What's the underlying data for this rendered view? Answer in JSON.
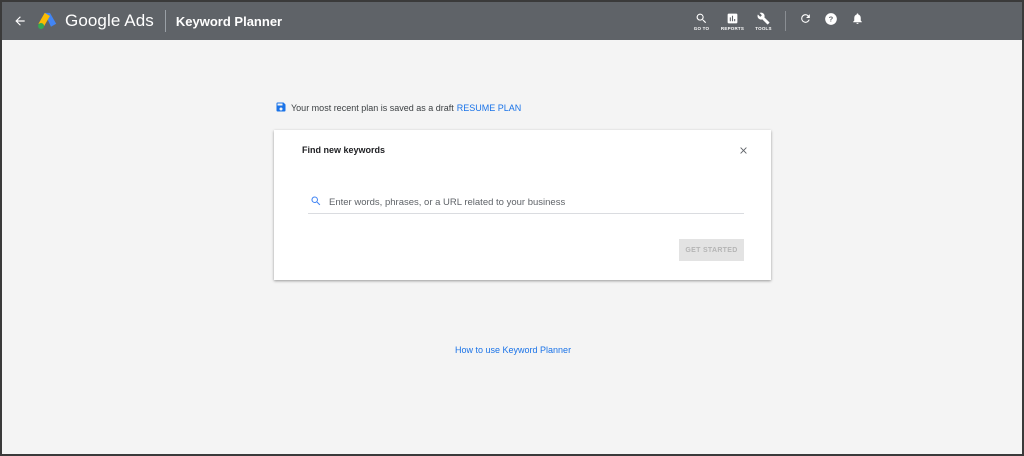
{
  "header": {
    "brand": "Google Ads",
    "page_title": "Keyword Planner",
    "background_color": "#5f6368",
    "tools": [
      {
        "label": "GO TO",
        "icon": "search-icon"
      },
      {
        "label": "REPORTS",
        "icon": "reports-icon"
      },
      {
        "label": "TOOLS",
        "icon": "wrench-icon"
      }
    ],
    "actions": [
      {
        "icon": "refresh-icon"
      },
      {
        "icon": "help-icon"
      },
      {
        "icon": "bell-icon"
      }
    ]
  },
  "draft_notice": {
    "text": "Your most recent plan is saved as a draft",
    "link": "RESUME PLAN",
    "icon": "save-icon"
  },
  "card": {
    "title": "Find new keywords",
    "search_placeholder": "Enter words, phrases, or a URL related to your business",
    "search_value": "",
    "button": "GET STARTED"
  },
  "footer_link": "How to use Keyword Planner",
  "colors": {
    "link": "#1a73e8",
    "page_bg": "#f4f4f4"
  }
}
